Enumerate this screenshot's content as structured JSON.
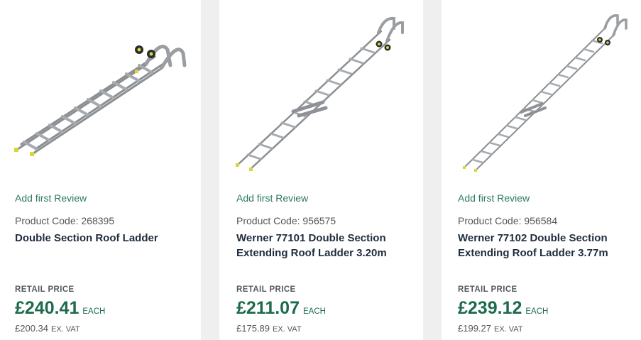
{
  "products": [
    {
      "image_alt": "roof-ladder-image",
      "review_link": "Add first Review",
      "product_code": "Product Code: 268395",
      "name": "Double Section Roof Ladder",
      "retail_label": "RETAIL PRICE",
      "price": "£240.41",
      "each_label": "EACH",
      "ex_vat_price": "£200.34",
      "ex_vat_label": "EX. VAT"
    },
    {
      "image_alt": "roof-ladder-image",
      "review_link": "Add first Review",
      "product_code": "Product Code: 956575",
      "name": "Werner 77101 Double Section Extending Roof Ladder 3.20m",
      "retail_label": "RETAIL PRICE",
      "price": "£211.07",
      "each_label": "EACH",
      "ex_vat_price": "£175.89",
      "ex_vat_label": "EX. VAT"
    },
    {
      "image_alt": "roof-ladder-image",
      "review_link": "Add first Review",
      "product_code": "Product Code: 956584",
      "name": "Werner 77102 Double Section Extending Roof Ladder 3.77m",
      "retail_label": "RETAIL PRICE",
      "price": "£239.12",
      "each_label": "EACH",
      "ex_vat_price": "£199.27",
      "ex_vat_label": "EX. VAT"
    }
  ],
  "colors": {
    "price_green": "#1d6b4c",
    "review_green": "#2e7a5c",
    "title_dark": "#1f2d3d",
    "gutter_gray": "#efefef"
  }
}
